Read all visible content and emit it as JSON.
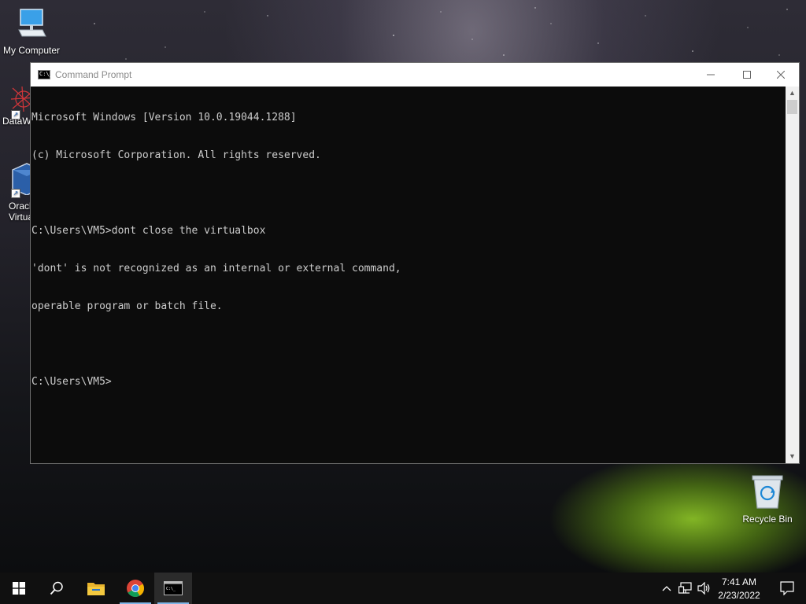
{
  "desktop": {
    "icons": [
      {
        "label": "My Computer",
        "icon": "monitor-icon"
      },
      {
        "label": "DataW",
        "icon": "datawrapper-icon"
      },
      {
        "label": "Oracl",
        "label2": "Virtua",
        "icon": "virtualbox-icon"
      },
      {
        "label": "Recycle Bin",
        "icon": "recycle-bin-icon"
      }
    ]
  },
  "window": {
    "title": "Command Prompt",
    "minimize": "—",
    "maximize": "☐",
    "close": "✕",
    "lines": [
      "Microsoft Windows [Version 10.0.19044.1288]",
      "(c) Microsoft Corporation. All rights reserved.",
      "",
      "C:\\Users\\VM5>dont close the virtualbox",
      "'dont' is not recognized as an internal or external command,",
      "operable program or batch file.",
      "",
      "C:\\Users\\VM5>"
    ]
  },
  "taskbar": {
    "items": [
      "start-icon",
      "search-icon",
      "file-explorer-icon",
      "chrome-icon",
      "command-prompt-icon"
    ],
    "clock": {
      "time": "7:41 AM",
      "date": "2/23/2022"
    }
  },
  "colors": {
    "console_bg": "#0c0c0c",
    "console_text": "#cccccc",
    "taskbar_bg": "#101010",
    "active_indicator": "#7fb5e6"
  }
}
